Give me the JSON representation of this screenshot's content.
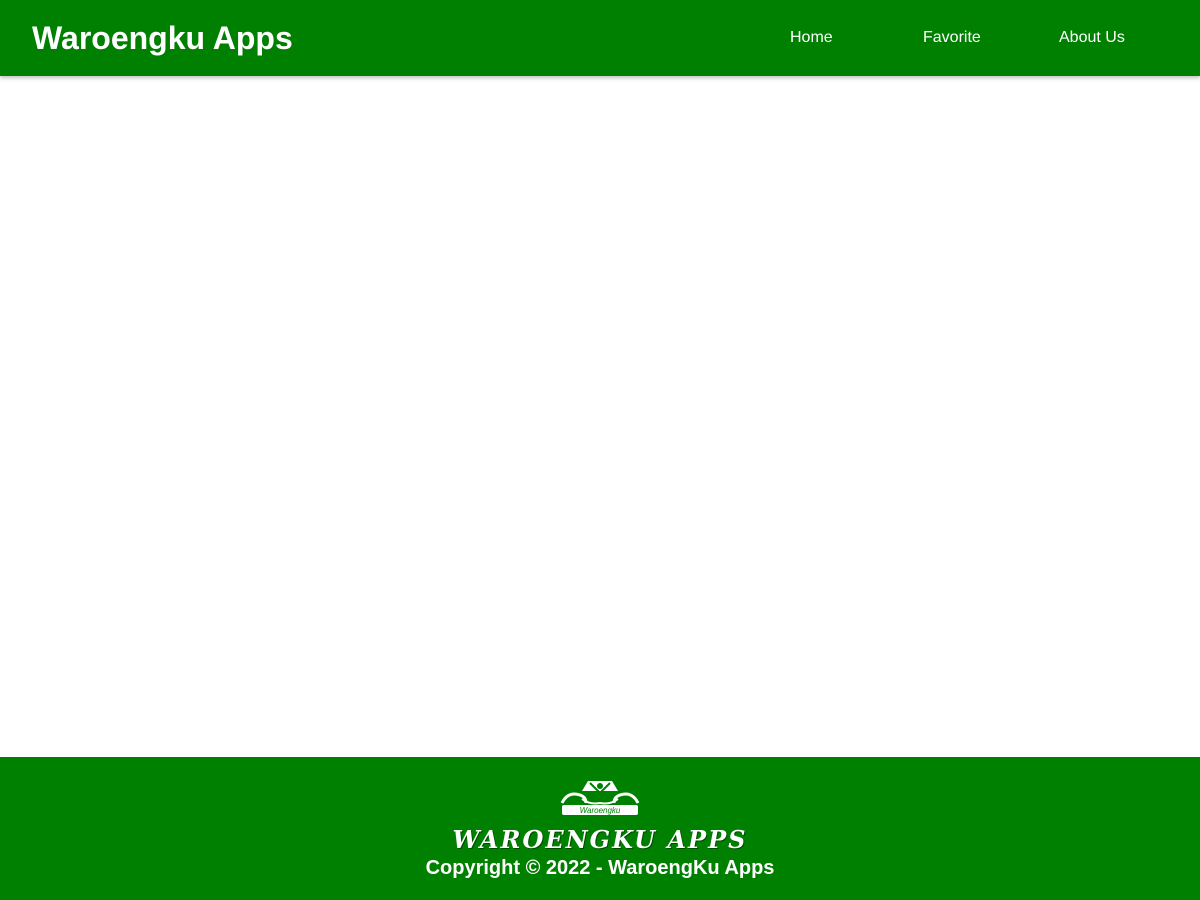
{
  "header": {
    "brand": "Waroengku Apps",
    "nav": [
      {
        "label": "Home"
      },
      {
        "label": "Favorite"
      },
      {
        "label": "About Us"
      }
    ]
  },
  "footer": {
    "logo_icon": "waroengku-logo-icon",
    "logo_text": "Waroengku",
    "title": "WAROENGKU APPS",
    "copyright": "Copyright © 2022 - WaroengKu Apps"
  },
  "colors": {
    "primary": "#008000",
    "text_on_primary": "#ffffff",
    "background": "#ffffff"
  }
}
